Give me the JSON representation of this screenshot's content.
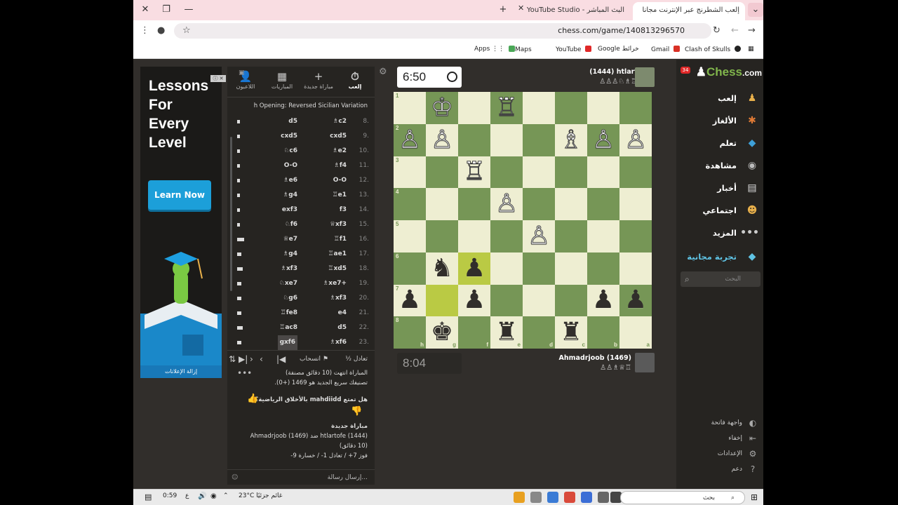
{
  "browser": {
    "tabs": [
      {
        "label": "إلعب الشطرنج عبر الإنترنت مجانا"
      },
      {
        "label": "البث المباشر - YouTube Studio"
      }
    ],
    "url": "chess.com/game/140813296570",
    "bookmarks": [
      "Apps",
      "Maps",
      "YouTube",
      "Google خرائط",
      "Gmail",
      "Clash of Skulls"
    ]
  },
  "ad": {
    "title": [
      "Lessons",
      "For",
      "Every",
      "Level"
    ],
    "button": "Learn Now",
    "remove": "إزالة الإعلانات",
    "adchoices": "ⓘ ✕"
  },
  "panel": {
    "tabs": [
      {
        "label": "إلعب",
        "icon": "⏱"
      },
      {
        "label": "مباراة جديدة",
        "icon": "+"
      },
      {
        "label": "المباريات",
        "icon": "▦"
      },
      {
        "label": "اللاعبون",
        "icon": "👤"
      }
    ],
    "opening": "h Opening: Reversed Sicilian Variation",
    "moves": [
      {
        "n": "8.",
        "w": "♗c2",
        "b": "d5"
      },
      {
        "n": "9.",
        "w": "cxd5",
        "b": "cxd5"
      },
      {
        "n": "10.",
        "w": "♗e2",
        "b": "♘c6"
      },
      {
        "n": "11.",
        "w": "♗f4",
        "b": "O-O"
      },
      {
        "n": "12.",
        "w": "O-O",
        "b": "♗e6"
      },
      {
        "n": "13.",
        "w": "♖e1",
        "b": "♗g4"
      },
      {
        "n": "14.",
        "w": "f3",
        "b": "exf3"
      },
      {
        "n": "15.",
        "w": "♕xf3",
        "b": "♘f6"
      },
      {
        "n": "16.",
        "w": "♖f1",
        "b": "♕e7"
      },
      {
        "n": "17.",
        "w": "♖ae1",
        "b": "♗g4"
      },
      {
        "n": "18.",
        "w": "♖xd5",
        "b": "♗xf3"
      },
      {
        "n": "19.",
        "w": "♗xe7+",
        "b": "♘xe7"
      },
      {
        "n": "20.",
        "w": "♗xf3",
        "b": "♘g6"
      },
      {
        "n": "21.",
        "w": "e4",
        "b": "♖fe8"
      },
      {
        "n": "22.",
        "w": "d5",
        "b": "♖ac8"
      },
      {
        "n": "23.",
        "w": "♗xf6",
        "b": "gxf6"
      }
    ],
    "controls": {
      "draw": "½ تعادل",
      "resign": "انسحاب"
    },
    "chat": [
      "المباراة انتهت (10 دقائق مصنفة)",
      "تصنيفك سريع الجديد هو 1469 (+0).",
      "هل تمتع mahdiidd بالأخلاق الرياضية؟",
      "مباراة جديدة",
      "htlartofe (1444) ضد Ahmadrjoob (1469)",
      "(10 دقائق)",
      "فوز 7+ / تعادل 1- / خسارة 9-"
    ],
    "chat_placeholder": "إرسال رسالة..."
  },
  "game": {
    "clock_top": "6:50",
    "clock_bottom": "8:04",
    "top_player": {
      "name": "htlartofe",
      "rating": "(1444)",
      "captures": "♙♙♙♘♗♖ +1"
    },
    "bottom_player": {
      "name": "Ahmadrjoob",
      "rating": "(1469)",
      "captures": "♙♙♗♕♖"
    },
    "files_bottom": [
      "h",
      "g",
      "f",
      "e",
      "d",
      "c",
      "b",
      "a"
    ],
    "ranks_left": [
      "1",
      "2",
      "3",
      "4",
      "5",
      "6",
      "7",
      "8"
    ],
    "board": [
      [
        "",
        "♔",
        "",
        "♖",
        "",
        "",
        "",
        ""
      ],
      [
        "♙",
        "♙",
        "",
        "",
        "",
        "♗",
        "♙",
        "♙"
      ],
      [
        "",
        "",
        "♖",
        "",
        "",
        "",
        "",
        ""
      ],
      [
        "",
        "",
        "",
        "♙",
        "",
        "",
        "",
        ""
      ],
      [
        "",
        "",
        "",
        "",
        "♙",
        "",
        "",
        ""
      ],
      [
        "",
        "♞",
        "♟",
        "",
        "",
        "",
        "",
        ""
      ],
      [
        "♟",
        "",
        "♟",
        "",
        "",
        "",
        "♟",
        "♟"
      ],
      [
        "",
        "♚",
        "",
        "♜",
        "",
        "♜",
        "",
        ""
      ]
    ]
  },
  "nav": {
    "logo_a": "Chess",
    "logo_b": ".com",
    "badge": "34",
    "items": [
      {
        "label": "إلعب",
        "icon": "♟",
        "color": "#e8b04b"
      },
      {
        "label": "الألغاز",
        "icon": "✱",
        "color": "#e07a35"
      },
      {
        "label": "تعلم",
        "icon": "◆",
        "color": "#3ea0d8"
      },
      {
        "label": "مشاهدة",
        "icon": "◉",
        "color": "#bbbbbb"
      },
      {
        "label": "أخبار",
        "icon": "▤",
        "color": "#dddddd"
      },
      {
        "label": "اجتماعي",
        "icon": "☻",
        "color": "#e8b04b"
      },
      {
        "label": "المزيد",
        "icon": "•••",
        "color": "#cccccc"
      },
      {
        "label": "تجربة مجانية",
        "icon": "◆",
        "color": "#5fc3e4"
      }
    ],
    "search_placeholder": "البحث",
    "bottom": [
      "واجهة فاتحة",
      "إخفاء",
      "الإعدادات",
      "دعم"
    ]
  },
  "taskbar": {
    "time": "0:59",
    "weather": "23°C غائم جزئيًا",
    "search": "بحث",
    "lang": "ع"
  }
}
